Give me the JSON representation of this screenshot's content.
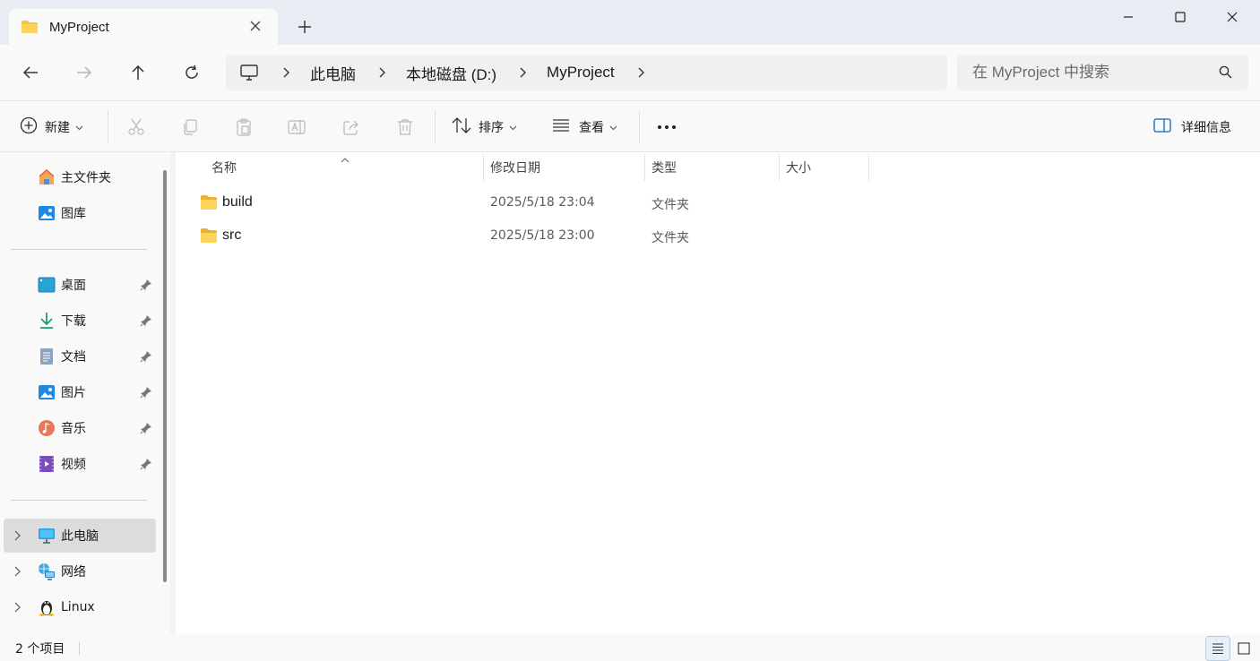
{
  "window": {
    "tab_title": "MyProject",
    "new_tab_icon": "plus-icon",
    "controls": [
      "minimize-icon",
      "maximize-icon",
      "close-icon"
    ]
  },
  "address": {
    "root_icon": "this-pc-icon",
    "crumbs": [
      "此电脑",
      "本地磁盘 (D:)",
      "MyProject"
    ]
  },
  "search": {
    "placeholder": "在 MyProject 中搜索"
  },
  "toolbar": {
    "new_label": "新建",
    "sort_label": "排序",
    "view_label": "查看",
    "details_label": "详细信息"
  },
  "sidebar": {
    "quick": [
      {
        "label": "主文件夹",
        "icon": "home-icon"
      },
      {
        "label": "图库",
        "icon": "gallery-icon"
      }
    ],
    "pinned": [
      {
        "label": "桌面",
        "icon": "desktop-icon"
      },
      {
        "label": "下载",
        "icon": "download-icon"
      },
      {
        "label": "文档",
        "icon": "documents-icon"
      },
      {
        "label": "图片",
        "icon": "pictures-icon"
      },
      {
        "label": "音乐",
        "icon": "music-icon"
      },
      {
        "label": "视频",
        "icon": "videos-icon"
      }
    ],
    "locations": [
      {
        "label": "此电脑",
        "icon": "this-pc-icon",
        "selected": true
      },
      {
        "label": "网络",
        "icon": "network-icon"
      },
      {
        "label": "Linux",
        "icon": "linux-icon"
      }
    ]
  },
  "columns": {
    "name": "名称",
    "modified": "修改日期",
    "type": "类型",
    "size": "大小"
  },
  "files": [
    {
      "name": "build",
      "modified": "2025/5/18 23:04",
      "type": "文件夹",
      "size": ""
    },
    {
      "name": "src",
      "modified": "2025/5/18 23:00",
      "type": "文件夹",
      "size": ""
    }
  ],
  "status": {
    "item_count": "2 个项目"
  },
  "colors": {
    "accent": "#0067c0",
    "folder": "#f6c344",
    "selected_bg": "#dcdcdc"
  }
}
